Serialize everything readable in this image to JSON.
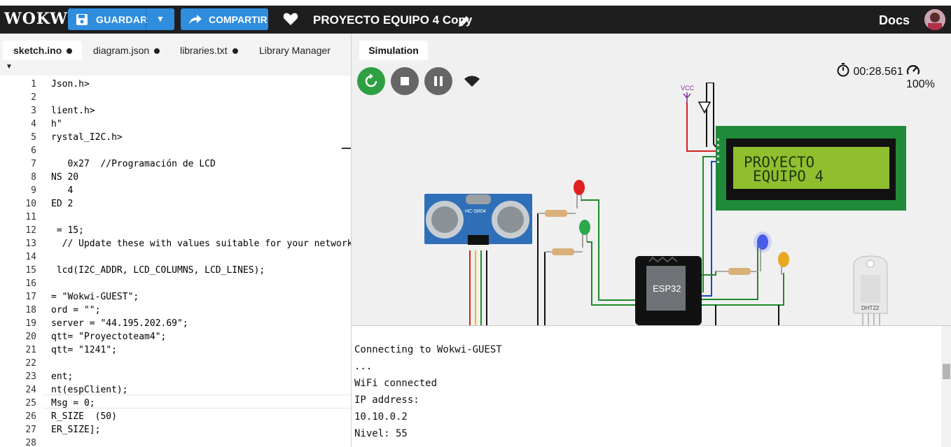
{
  "header": {
    "logo": "WOKWi",
    "save_label": "GUARDAR",
    "share_label": "COMPARTIR",
    "project_title": "PROYECTO EQUIPO 4 Copy",
    "docs_label": "Docs"
  },
  "editor": {
    "tabs": [
      {
        "label": "sketch.ino",
        "modified": true
      },
      {
        "label": "diagram.json",
        "modified": true
      },
      {
        "label": "libraries.txt",
        "modified": true
      },
      {
        "label": "Library Manager",
        "modified": false
      }
    ],
    "lines": [
      {
        "n": "1",
        "t": "Json.h>"
      },
      {
        "n": "2",
        "t": ""
      },
      {
        "n": "3",
        "t": "lient.h>"
      },
      {
        "n": "4",
        "t": "h\""
      },
      {
        "n": "5",
        "t": "rystal_I2C.h>"
      },
      {
        "n": "6",
        "t": ""
      },
      {
        "n": "7",
        "t": "   0x27  //Programación de LCD"
      },
      {
        "n": "8",
        "t": "NS 20"
      },
      {
        "n": "9",
        "t": "   4"
      },
      {
        "n": "10",
        "t": "ED 2"
      },
      {
        "n": "11",
        "t": ""
      },
      {
        "n": "12",
        "t": " = 15;"
      },
      {
        "n": "13",
        "t": "  // Update these with values suitable for your network."
      },
      {
        "n": "14",
        "t": ""
      },
      {
        "n": "15",
        "t": " lcd(I2C_ADDR, LCD_COLUMNS, LCD_LINES);"
      },
      {
        "n": "16",
        "t": ""
      },
      {
        "n": "17",
        "t": "= \"Wokwi-GUEST\";"
      },
      {
        "n": "18",
        "t": "ord = \"\";"
      },
      {
        "n": "19",
        "t": "server = \"44.195.202.69\";"
      },
      {
        "n": "20",
        "t": "qtt= \"Proyectoteam4\";"
      },
      {
        "n": "21",
        "t": "qtt= \"1241\";"
      },
      {
        "n": "22",
        "t": ""
      },
      {
        "n": "23",
        "t": "ent;"
      },
      {
        "n": "24",
        "t": "nt(espClient);"
      },
      {
        "n": "25",
        "t": "Msg = 0;"
      },
      {
        "n": "26",
        "t": "R_SIZE  (50)"
      },
      {
        "n": "27",
        "t": "ER_SIZE];"
      },
      {
        "n": "28",
        "t": ""
      }
    ]
  },
  "simulation": {
    "tab_label": "Simulation",
    "timer": "00:28.561",
    "speed": "100%",
    "lcd_line1": "PROYECTO",
    "lcd_line2": "EQUIPO 4",
    "vcc_label": "VCC",
    "esp_label": "ESP32",
    "ultrasonic_label": "HC-SR04",
    "dht_label": "DHT22"
  },
  "serial": {
    "lines": [
      "Connecting to Wokwi-GUEST",
      "...",
      "WiFi connected",
      "IP address:",
      "10.10.0.2",
      "Nivel: 55"
    ]
  },
  "colors": {
    "header_bg": "#1e1e1e",
    "accent": "#2f8dde",
    "restart": "#2ea043",
    "wire_green": "#1e8a2e",
    "lcd_bg": "#8fbf2f"
  }
}
